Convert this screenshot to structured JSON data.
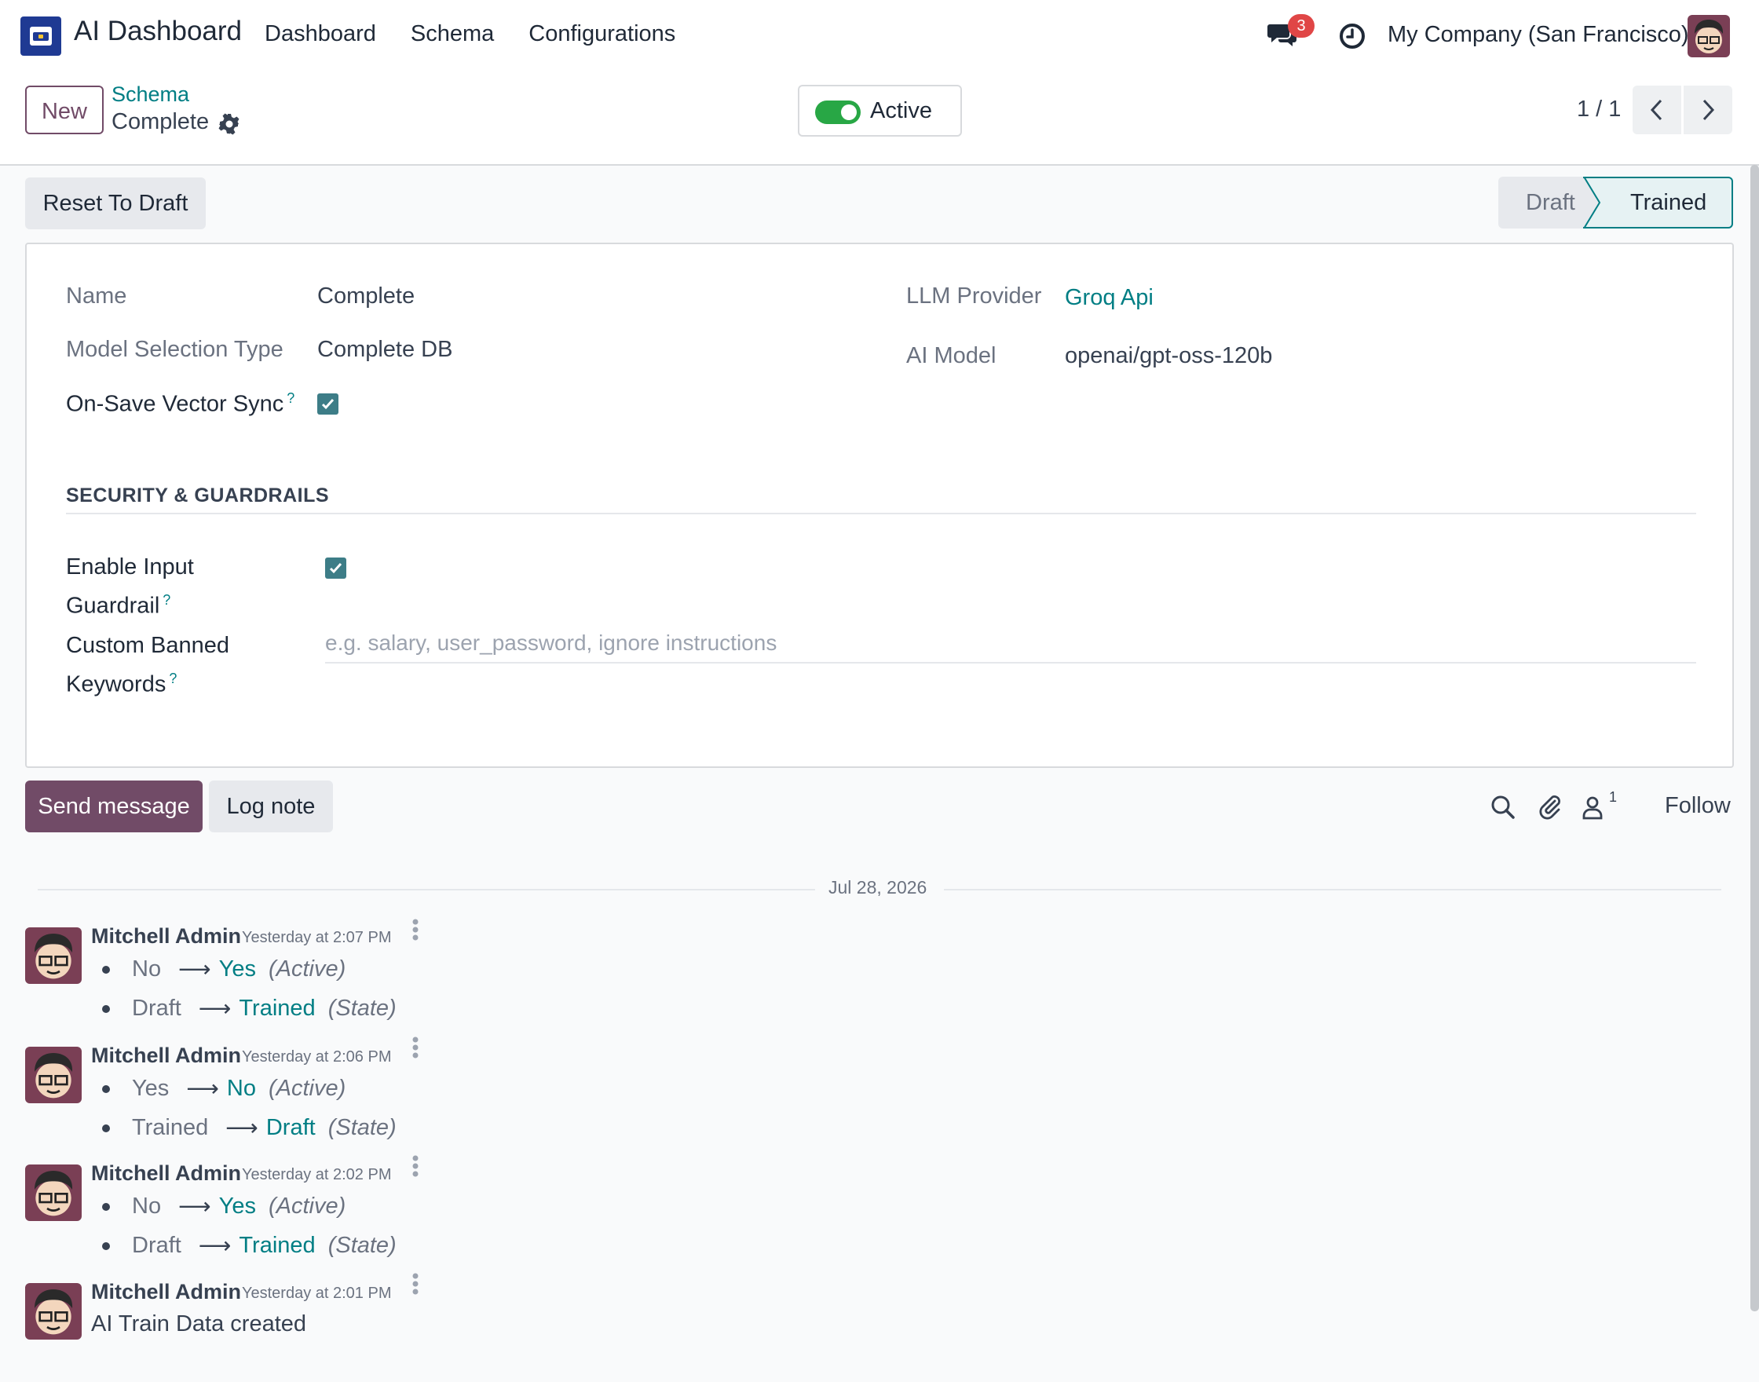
{
  "navbar": {
    "app_title": "AI Dashboard",
    "menu": [
      "Dashboard",
      "Schema",
      "Configurations"
    ],
    "chat_badge": "3",
    "company": "My Company (San Francisco)"
  },
  "control_panel": {
    "new_label": "New",
    "breadcrumb_parent": "Schema",
    "breadcrumb_current": "Complete",
    "active_label": "Active",
    "pager_value": "1 / 1"
  },
  "statusbar": {
    "reset_label": "Reset To Draft",
    "stages": [
      "Draft",
      "Trained"
    ],
    "current_stage": "Trained"
  },
  "form": {
    "name_label": "Name",
    "name_value": "Complete",
    "model_selection_label": "Model Selection Type",
    "model_selection_value": "Complete DB",
    "vector_sync_label": "On-Save Vector Sync",
    "vector_sync_checked": true,
    "llm_provider_label": "LLM Provider",
    "llm_provider_value": "Groq Api",
    "ai_model_label": "AI Model",
    "ai_model_value": "openai/gpt-oss-120b",
    "section_title": "SECURITY & GUARDRAILS",
    "input_guardrail_label_1": "Enable Input",
    "input_guardrail_label_2": "Guardrail",
    "input_guardrail_checked": true,
    "banned_keywords_label_1": "Custom Banned",
    "banned_keywords_label_2": "Keywords",
    "banned_keywords_value": "",
    "banned_keywords_placeholder": "e.g. salary, user_password, ignore instructions",
    "help_mark": "?"
  },
  "chatter": {
    "send_message_label": "Send message",
    "log_note_label": "Log note",
    "follower_count": "1",
    "follow_label": "Follow",
    "date_separator": "Jul 28, 2026",
    "messages": [
      {
        "author": "Mitchell Admin",
        "time": "Yesterday at 2:07 PM",
        "changes": [
          {
            "old": "No",
            "new": "Yes",
            "field": "(Active)"
          },
          {
            "old": "Draft",
            "new": "Trained",
            "field": "(State)"
          }
        ]
      },
      {
        "author": "Mitchell Admin",
        "time": "Yesterday at 2:06 PM",
        "changes": [
          {
            "old": "Yes",
            "new": "No",
            "field": "(Active)"
          },
          {
            "old": "Trained",
            "new": "Draft",
            "field": "(State)"
          }
        ]
      },
      {
        "author": "Mitchell Admin",
        "time": "Yesterday at 2:02 PM",
        "changes": [
          {
            "old": "No",
            "new": "Yes",
            "field": "(Active)"
          },
          {
            "old": "Draft",
            "new": "Trained",
            "field": "(State)"
          }
        ]
      },
      {
        "author": "Mitchell Admin",
        "time": "Yesterday at 2:01 PM",
        "body": "AI Train Data created"
      }
    ]
  },
  "colors": {
    "brand": "#714b67",
    "link": "#017e84",
    "toggle_on": "#28a745",
    "checkbox": "#3d7d87",
    "badge": "#e04646"
  }
}
